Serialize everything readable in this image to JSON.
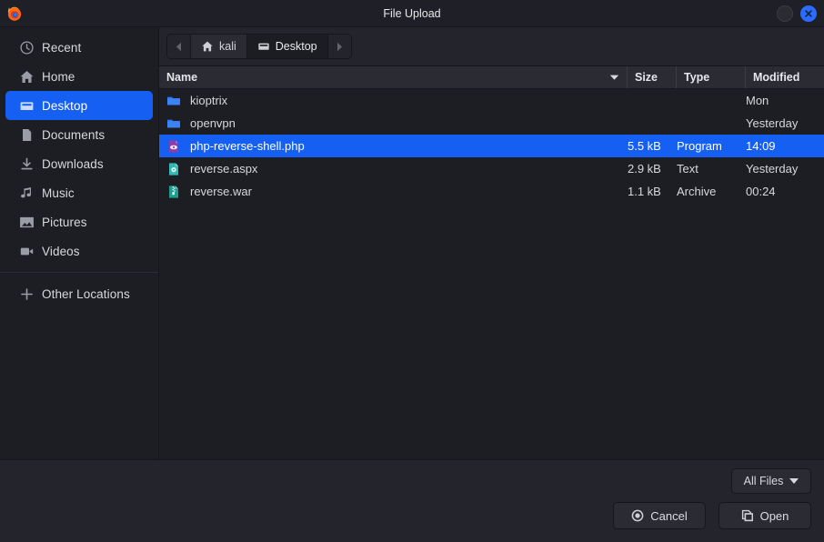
{
  "titlebar": {
    "title": "File Upload",
    "app_icon": "firefox-icon",
    "minimize_label": "",
    "close_label": "",
    "close_color": "#2b6cff"
  },
  "sidebar": {
    "items": [
      {
        "label": "Recent",
        "icon": "clock-icon",
        "selected": false
      },
      {
        "label": "Home",
        "icon": "home-icon",
        "selected": false
      },
      {
        "label": "Desktop",
        "icon": "desktop-icon",
        "selected": true
      },
      {
        "label": "Documents",
        "icon": "document-icon",
        "selected": false
      },
      {
        "label": "Downloads",
        "icon": "download-icon",
        "selected": false
      },
      {
        "label": "Music",
        "icon": "music-icon",
        "selected": false
      },
      {
        "label": "Pictures",
        "icon": "image-icon",
        "selected": false
      },
      {
        "label": "Videos",
        "icon": "video-icon",
        "selected": false
      },
      {
        "label": "Other Locations",
        "icon": "plus-icon",
        "selected": false
      }
    ],
    "selection_color": "#1560f2"
  },
  "pathbar": {
    "back_label": "",
    "forward_label": "",
    "crumbs": [
      {
        "label": "kali",
        "icon": "home-icon",
        "active": false
      },
      {
        "label": "Desktop",
        "icon": "desktop-icon",
        "active": true
      }
    ]
  },
  "columns": {
    "name": "Name",
    "size": "Size",
    "type": "Type",
    "modified": "Modified",
    "sort_column": "Name",
    "sort_direction": "descending"
  },
  "files": [
    {
      "name": "kioptrix",
      "size": "",
      "type": "",
      "modified": "Mon",
      "icon": "folder-icon",
      "selected": false
    },
    {
      "name": "openvpn",
      "size": "",
      "type": "",
      "modified": "Yesterday",
      "icon": "folder-icon",
      "selected": false
    },
    {
      "name": "php-reverse-shell.php",
      "size": "5.5 kB",
      "type": "Program",
      "modified": "14:09",
      "icon": "php-file-icon",
      "selected": true
    },
    {
      "name": "reverse.aspx",
      "size": "2.9 kB",
      "type": "Text",
      "modified": "Yesterday",
      "icon": "text-file-icon",
      "selected": false
    },
    {
      "name": "reverse.war",
      "size": "1.1 kB",
      "type": "Archive",
      "modified": "00:24",
      "icon": "archive-file-icon",
      "selected": false
    }
  ],
  "footer": {
    "filter_label": "All Files",
    "cancel_label": "Cancel",
    "open_label": "Open"
  }
}
